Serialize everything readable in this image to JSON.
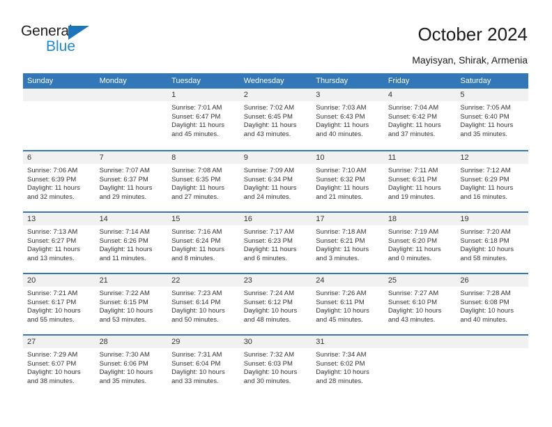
{
  "brand": {
    "name_top": "General",
    "name_bottom": "Blue",
    "triangle_color": "#1b75bb",
    "blue_text_color": "#1b8ad6"
  },
  "header": {
    "title": "October 2024",
    "subtitle": "Mayisyan, Shirak, Armenia"
  },
  "theme": {
    "header_blue": "#3277b8",
    "daynum_band": "#f1f1f1",
    "text": "#333333"
  },
  "calendar": {
    "weekday_headers": [
      "Sunday",
      "Monday",
      "Tuesday",
      "Wednesday",
      "Thursday",
      "Friday",
      "Saturday"
    ],
    "weeks": [
      [
        {
          "day": "",
          "sunrise": "",
          "sunset": "",
          "daylight_line1": "",
          "daylight_line2": ""
        },
        {
          "day": "",
          "sunrise": "",
          "sunset": "",
          "daylight_line1": "",
          "daylight_line2": ""
        },
        {
          "day": "1",
          "sunrise": "Sunrise: 7:01 AM",
          "sunset": "Sunset: 6:47 PM",
          "daylight_line1": "Daylight: 11 hours",
          "daylight_line2": "and 45 minutes."
        },
        {
          "day": "2",
          "sunrise": "Sunrise: 7:02 AM",
          "sunset": "Sunset: 6:45 PM",
          "daylight_line1": "Daylight: 11 hours",
          "daylight_line2": "and 43 minutes."
        },
        {
          "day": "3",
          "sunrise": "Sunrise: 7:03 AM",
          "sunset": "Sunset: 6:43 PM",
          "daylight_line1": "Daylight: 11 hours",
          "daylight_line2": "and 40 minutes."
        },
        {
          "day": "4",
          "sunrise": "Sunrise: 7:04 AM",
          "sunset": "Sunset: 6:42 PM",
          "daylight_line1": "Daylight: 11 hours",
          "daylight_line2": "and 37 minutes."
        },
        {
          "day": "5",
          "sunrise": "Sunrise: 7:05 AM",
          "sunset": "Sunset: 6:40 PM",
          "daylight_line1": "Daylight: 11 hours",
          "daylight_line2": "and 35 minutes."
        }
      ],
      [
        {
          "day": "6",
          "sunrise": "Sunrise: 7:06 AM",
          "sunset": "Sunset: 6:39 PM",
          "daylight_line1": "Daylight: 11 hours",
          "daylight_line2": "and 32 minutes."
        },
        {
          "day": "7",
          "sunrise": "Sunrise: 7:07 AM",
          "sunset": "Sunset: 6:37 PM",
          "daylight_line1": "Daylight: 11 hours",
          "daylight_line2": "and 29 minutes."
        },
        {
          "day": "8",
          "sunrise": "Sunrise: 7:08 AM",
          "sunset": "Sunset: 6:35 PM",
          "daylight_line1": "Daylight: 11 hours",
          "daylight_line2": "and 27 minutes."
        },
        {
          "day": "9",
          "sunrise": "Sunrise: 7:09 AM",
          "sunset": "Sunset: 6:34 PM",
          "daylight_line1": "Daylight: 11 hours",
          "daylight_line2": "and 24 minutes."
        },
        {
          "day": "10",
          "sunrise": "Sunrise: 7:10 AM",
          "sunset": "Sunset: 6:32 PM",
          "daylight_line1": "Daylight: 11 hours",
          "daylight_line2": "and 21 minutes."
        },
        {
          "day": "11",
          "sunrise": "Sunrise: 7:11 AM",
          "sunset": "Sunset: 6:31 PM",
          "daylight_line1": "Daylight: 11 hours",
          "daylight_line2": "and 19 minutes."
        },
        {
          "day": "12",
          "sunrise": "Sunrise: 7:12 AM",
          "sunset": "Sunset: 6:29 PM",
          "daylight_line1": "Daylight: 11 hours",
          "daylight_line2": "and 16 minutes."
        }
      ],
      [
        {
          "day": "13",
          "sunrise": "Sunrise: 7:13 AM",
          "sunset": "Sunset: 6:27 PM",
          "daylight_line1": "Daylight: 11 hours",
          "daylight_line2": "and 13 minutes."
        },
        {
          "day": "14",
          "sunrise": "Sunrise: 7:14 AM",
          "sunset": "Sunset: 6:26 PM",
          "daylight_line1": "Daylight: 11 hours",
          "daylight_line2": "and 11 minutes."
        },
        {
          "day": "15",
          "sunrise": "Sunrise: 7:16 AM",
          "sunset": "Sunset: 6:24 PM",
          "daylight_line1": "Daylight: 11 hours",
          "daylight_line2": "and 8 minutes."
        },
        {
          "day": "16",
          "sunrise": "Sunrise: 7:17 AM",
          "sunset": "Sunset: 6:23 PM",
          "daylight_line1": "Daylight: 11 hours",
          "daylight_line2": "and 6 minutes."
        },
        {
          "day": "17",
          "sunrise": "Sunrise: 7:18 AM",
          "sunset": "Sunset: 6:21 PM",
          "daylight_line1": "Daylight: 11 hours",
          "daylight_line2": "and 3 minutes."
        },
        {
          "day": "18",
          "sunrise": "Sunrise: 7:19 AM",
          "sunset": "Sunset: 6:20 PM",
          "daylight_line1": "Daylight: 11 hours",
          "daylight_line2": "and 0 minutes."
        },
        {
          "day": "19",
          "sunrise": "Sunrise: 7:20 AM",
          "sunset": "Sunset: 6:18 PM",
          "daylight_line1": "Daylight: 10 hours",
          "daylight_line2": "and 58 minutes."
        }
      ],
      [
        {
          "day": "20",
          "sunrise": "Sunrise: 7:21 AM",
          "sunset": "Sunset: 6:17 PM",
          "daylight_line1": "Daylight: 10 hours",
          "daylight_line2": "and 55 minutes."
        },
        {
          "day": "21",
          "sunrise": "Sunrise: 7:22 AM",
          "sunset": "Sunset: 6:15 PM",
          "daylight_line1": "Daylight: 10 hours",
          "daylight_line2": "and 53 minutes."
        },
        {
          "day": "22",
          "sunrise": "Sunrise: 7:23 AM",
          "sunset": "Sunset: 6:14 PM",
          "daylight_line1": "Daylight: 10 hours",
          "daylight_line2": "and 50 minutes."
        },
        {
          "day": "23",
          "sunrise": "Sunrise: 7:24 AM",
          "sunset": "Sunset: 6:12 PM",
          "daylight_line1": "Daylight: 10 hours",
          "daylight_line2": "and 48 minutes."
        },
        {
          "day": "24",
          "sunrise": "Sunrise: 7:26 AM",
          "sunset": "Sunset: 6:11 PM",
          "daylight_line1": "Daylight: 10 hours",
          "daylight_line2": "and 45 minutes."
        },
        {
          "day": "25",
          "sunrise": "Sunrise: 7:27 AM",
          "sunset": "Sunset: 6:10 PM",
          "daylight_line1": "Daylight: 10 hours",
          "daylight_line2": "and 43 minutes."
        },
        {
          "day": "26",
          "sunrise": "Sunrise: 7:28 AM",
          "sunset": "Sunset: 6:08 PM",
          "daylight_line1": "Daylight: 10 hours",
          "daylight_line2": "and 40 minutes."
        }
      ],
      [
        {
          "day": "27",
          "sunrise": "Sunrise: 7:29 AM",
          "sunset": "Sunset: 6:07 PM",
          "daylight_line1": "Daylight: 10 hours",
          "daylight_line2": "and 38 minutes."
        },
        {
          "day": "28",
          "sunrise": "Sunrise: 7:30 AM",
          "sunset": "Sunset: 6:06 PM",
          "daylight_line1": "Daylight: 10 hours",
          "daylight_line2": "and 35 minutes."
        },
        {
          "day": "29",
          "sunrise": "Sunrise: 7:31 AM",
          "sunset": "Sunset: 6:04 PM",
          "daylight_line1": "Daylight: 10 hours",
          "daylight_line2": "and 33 minutes."
        },
        {
          "day": "30",
          "sunrise": "Sunrise: 7:32 AM",
          "sunset": "Sunset: 6:03 PM",
          "daylight_line1": "Daylight: 10 hours",
          "daylight_line2": "and 30 minutes."
        },
        {
          "day": "31",
          "sunrise": "Sunrise: 7:34 AM",
          "sunset": "Sunset: 6:02 PM",
          "daylight_line1": "Daylight: 10 hours",
          "daylight_line2": "and 28 minutes."
        },
        {
          "day": "",
          "sunrise": "",
          "sunset": "",
          "daylight_line1": "",
          "daylight_line2": ""
        },
        {
          "day": "",
          "sunrise": "",
          "sunset": "",
          "daylight_line1": "",
          "daylight_line2": ""
        }
      ]
    ]
  }
}
